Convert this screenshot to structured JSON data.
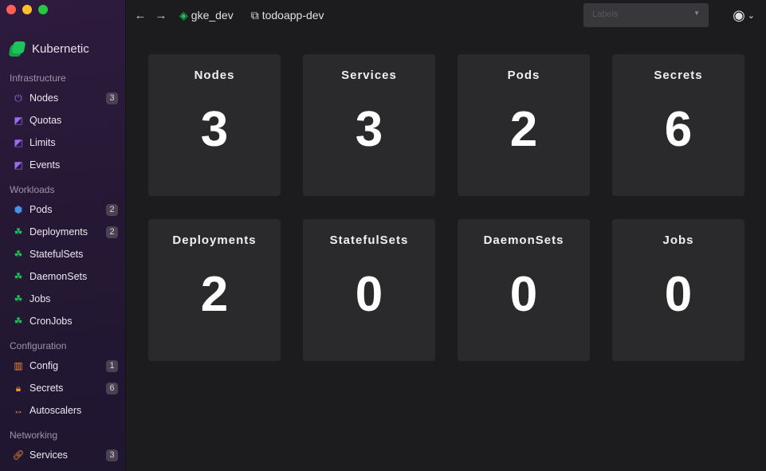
{
  "app": {
    "name": "Kubernetic"
  },
  "sidebar": {
    "sections": [
      {
        "title": "Infrastructure",
        "items": [
          {
            "label": "Nodes",
            "badge": "3"
          },
          {
            "label": "Quotas"
          },
          {
            "label": "Limits"
          },
          {
            "label": "Events"
          }
        ]
      },
      {
        "title": "Workloads",
        "items": [
          {
            "label": "Pods",
            "badge": "2"
          },
          {
            "label": "Deployments",
            "badge": "2"
          },
          {
            "label": "StatefulSets"
          },
          {
            "label": "DaemonSets"
          },
          {
            "label": "Jobs"
          },
          {
            "label": "CronJobs"
          }
        ]
      },
      {
        "title": "Configuration",
        "items": [
          {
            "label": "Config",
            "badge": "1"
          },
          {
            "label": "Secrets",
            "badge": "6"
          },
          {
            "label": "Autoscalers"
          }
        ]
      },
      {
        "title": "Networking",
        "items": [
          {
            "label": "Services",
            "badge": "3"
          }
        ]
      }
    ]
  },
  "topbar": {
    "cluster": "gke_dev",
    "namespace": "todoapp-dev",
    "labels_placeholder": "Labels"
  },
  "cards": [
    {
      "title": "Nodes",
      "value": "3"
    },
    {
      "title": "Services",
      "value": "3"
    },
    {
      "title": "Pods",
      "value": "2"
    },
    {
      "title": "Secrets",
      "value": "6"
    },
    {
      "title": "Deployments",
      "value": "2"
    },
    {
      "title": "StatefulSets",
      "value": "0"
    },
    {
      "title": "DaemonSets",
      "value": "0"
    },
    {
      "title": "Jobs",
      "value": "0"
    }
  ],
  "colors": {
    "accent_green": "#1ec45a",
    "purple": "#9b6cf0",
    "orange": "#f08a3c",
    "blue": "#4a90e2"
  }
}
